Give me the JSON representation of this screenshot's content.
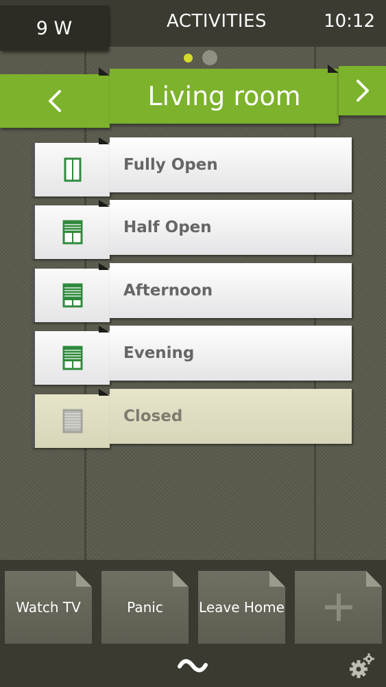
{
  "header": {
    "power": "9 W",
    "title": "ACTIVITIES",
    "time": "10:12"
  },
  "pager": {
    "active_index": 0,
    "count": 2
  },
  "room": {
    "name": "Living room",
    "prev_icon": "chevron-left-icon",
    "next_icon": "chevron-right-icon"
  },
  "activities": [
    {
      "label": "Fully Open",
      "icon": "window-open-icon",
      "enabled": true
    },
    {
      "label": "Half Open",
      "icon": "blind-half-icon",
      "enabled": true
    },
    {
      "label": "Afternoon",
      "icon": "blind-afternoon-icon",
      "enabled": true
    },
    {
      "label": "Evening",
      "icon": "blind-evening-icon",
      "enabled": true
    },
    {
      "label": "Closed",
      "icon": "blind-closed-icon",
      "enabled": false
    }
  ],
  "dock": {
    "tiles": [
      "Watch TV",
      "Panic",
      "Leave Home"
    ],
    "add_icon": "plus-icon",
    "home_icon": "logo-wave-icon",
    "settings_icon": "gear-icon"
  },
  "colors": {
    "accent": "#7cb22c",
    "pager_active": "#d5d92a",
    "icon_green": "#2f8a3c",
    "disabled_row": "#e0deC2"
  }
}
